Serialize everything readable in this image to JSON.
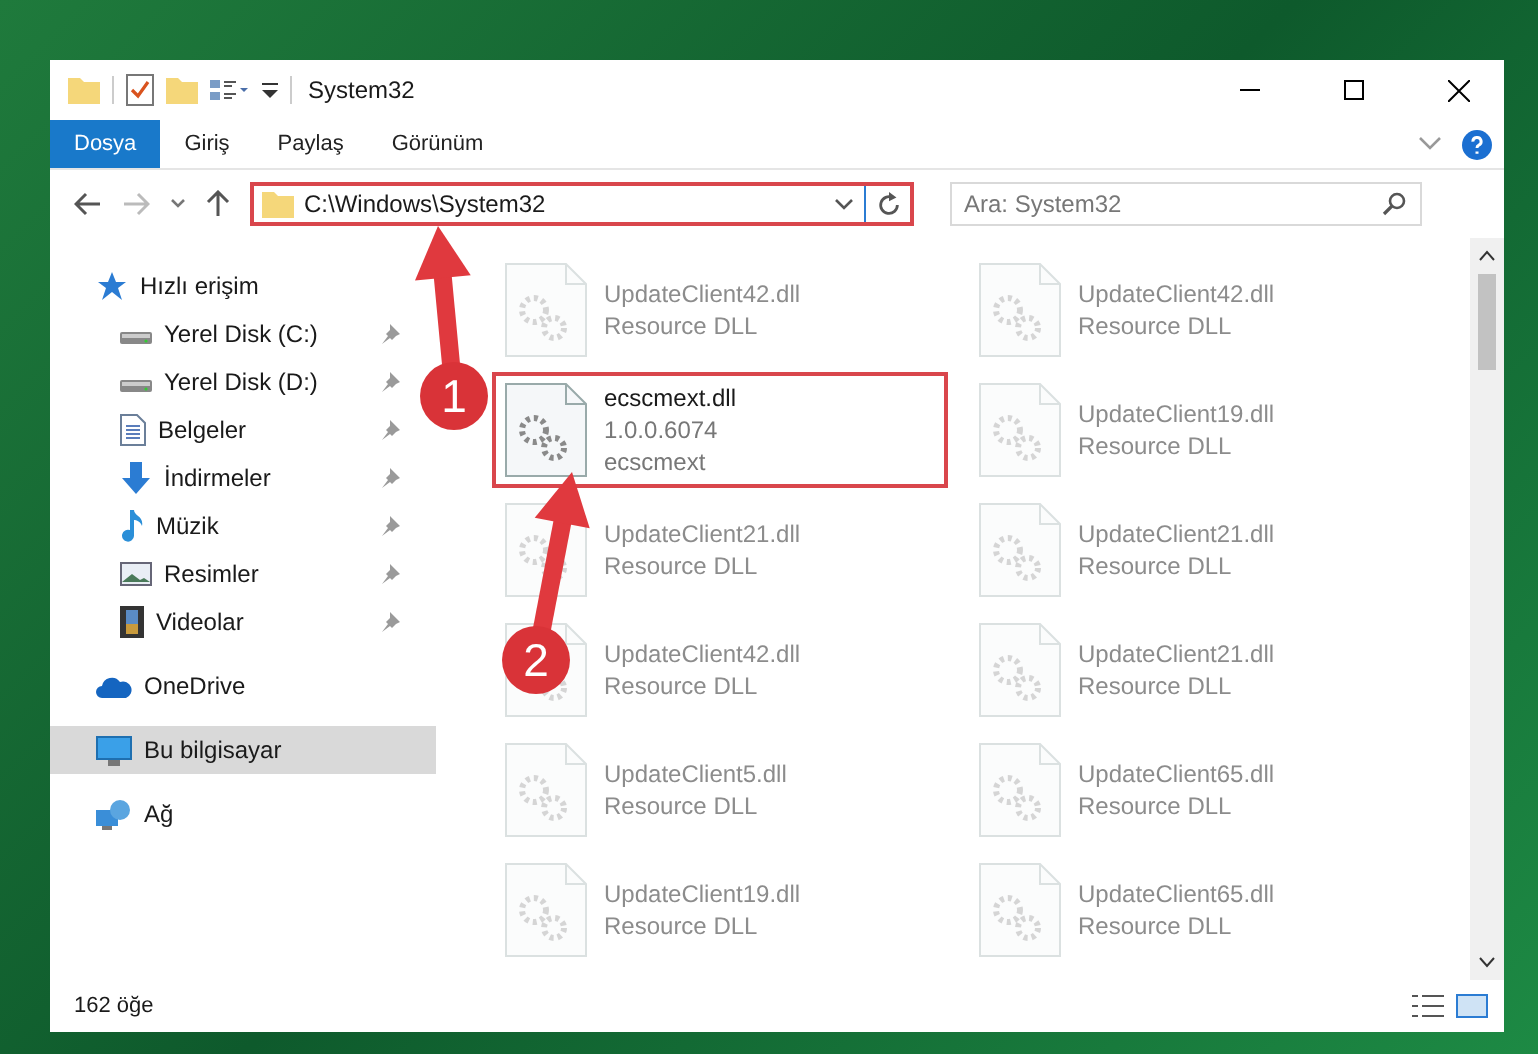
{
  "window": {
    "title": "System32"
  },
  "ribbon_tabs": [
    {
      "label": "Dosya",
      "selected": true
    },
    {
      "label": "Giriş",
      "selected": false
    },
    {
      "label": "Paylaş",
      "selected": false
    },
    {
      "label": "Görünüm",
      "selected": false
    }
  ],
  "address_bar": {
    "path": "C:\\Windows\\System32",
    "highlighted": true
  },
  "search": {
    "placeholder": "Ara: System32"
  },
  "sidebar": {
    "items": [
      {
        "label": "Hızlı erişim",
        "kind": "star",
        "selected": false,
        "children": [
          {
            "label": "Yerel Disk (C:)",
            "kind": "drive",
            "selected": false,
            "pinned": true
          },
          {
            "label": "Yerel Disk (D:)",
            "kind": "drive",
            "selected": false,
            "pinned": true
          },
          {
            "label": "Belgeler",
            "kind": "document",
            "selected": false,
            "pinned": true
          },
          {
            "label": "İndirmeler",
            "kind": "download",
            "selected": false,
            "pinned": true
          },
          {
            "label": "Müzik",
            "kind": "music",
            "selected": false,
            "pinned": true
          },
          {
            "label": "Resimler",
            "kind": "pictures",
            "selected": false,
            "pinned": true
          },
          {
            "label": "Videolar",
            "kind": "video",
            "selected": false,
            "pinned": true
          }
        ]
      },
      {
        "label": "OneDrive",
        "kind": "cloud",
        "selected": false
      },
      {
        "label": "Bu bilgisayar",
        "kind": "computer",
        "selected": true
      },
      {
        "label": "Ağ",
        "kind": "network",
        "selected": false
      }
    ]
  },
  "files": [
    {
      "name": "UpdateClient42.dll",
      "lines": [
        "Resource DLL"
      ],
      "faded": true,
      "highlighted": false
    },
    {
      "name": "UpdateClient42.dll",
      "lines": [
        "Resource DLL"
      ],
      "faded": true,
      "highlighted": false
    },
    {
      "name": "ecscmext.dll",
      "lines": [
        "1.0.0.6074",
        "ecscmext"
      ],
      "faded": false,
      "highlighted": true
    },
    {
      "name": "UpdateClient19.dll",
      "lines": [
        "Resource DLL"
      ],
      "faded": true,
      "highlighted": false
    },
    {
      "name": "UpdateClient21.dll",
      "lines": [
        "Resource DLL"
      ],
      "faded": true,
      "highlighted": false
    },
    {
      "name": "UpdateClient21.dll",
      "lines": [
        "Resource DLL"
      ],
      "faded": true,
      "highlighted": false
    },
    {
      "name": "UpdateClient42.dll",
      "lines": [
        "Resource DLL"
      ],
      "faded": true,
      "highlighted": false
    },
    {
      "name": "UpdateClient21.dll",
      "lines": [
        "Resource DLL"
      ],
      "faded": true,
      "highlighted": false
    },
    {
      "name": "UpdateClient5.dll",
      "lines": [
        "Resource DLL"
      ],
      "faded": true,
      "highlighted": false
    },
    {
      "name": "UpdateClient65.dll",
      "lines": [
        "Resource DLL"
      ],
      "faded": true,
      "highlighted": false
    },
    {
      "name": "UpdateClient19.dll",
      "lines": [
        "Resource DLL"
      ],
      "faded": true,
      "highlighted": false
    },
    {
      "name": "UpdateClient65.dll",
      "lines": [
        "Resource DLL"
      ],
      "faded": true,
      "highlighted": false
    }
  ],
  "status_bar": {
    "item_count": "162 öğe"
  },
  "annotations": [
    {
      "number": "1"
    },
    {
      "number": "2"
    }
  ]
}
